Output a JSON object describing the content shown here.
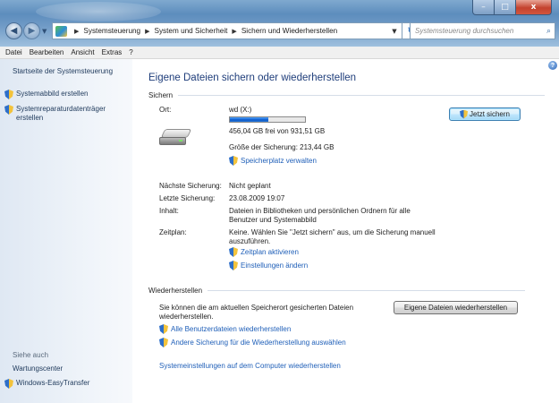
{
  "window": {
    "controls": {
      "minimize": "–",
      "maximize": "□",
      "close": "x"
    }
  },
  "address_bar": {
    "breadcrumbs": [
      "Systemsteuerung",
      "System und Sicherheit",
      "Sichern und Wiederherstellen"
    ],
    "search_placeholder": "Systemsteuerung durchsuchen"
  },
  "menubar": {
    "items": [
      "Datei",
      "Bearbeiten",
      "Ansicht",
      "Extras",
      "?"
    ]
  },
  "sidebar": {
    "home_link": "Startseite der Systemsteuerung",
    "links": [
      "Systemabbild erstellen",
      "Systemreparaturdatenträger",
      "erstellen"
    ],
    "see_also_heading": "Siehe auch",
    "see_also": [
      "Wartungscenter",
      "Windows-EasyTransfer"
    ]
  },
  "main": {
    "title": "Eigene Dateien sichern oder wiederherstellen",
    "backup": {
      "heading": "Sichern",
      "location_label": "Ort:",
      "drive_name": "wd (X:)",
      "drive_free": "456,04 GB frei von 931,51 GB",
      "drive_usage_fraction": 0.51,
      "backup_size": "Größe der Sicherung: 213,44 GB",
      "manage_space_link": "Speicherplatz verwalten",
      "backup_now_button": "Jetzt sichern",
      "next_backup_label": "Nächste Sicherung:",
      "next_backup_value": "Nicht geplant",
      "last_backup_label": "Letzte Sicherung:",
      "last_backup_value": "23.08.2009 19:07",
      "contents_label": "Inhalt:",
      "contents_value": [
        "Dateien in Bibliotheken und persönlichen Ordnern für alle",
        "Benutzer und Systemabbild"
      ],
      "schedule_label": "Zeitplan:",
      "schedule_value": [
        "Keine. Wählen Sie \"Jetzt sichern\" aus, um die Sicherung manuell",
        "auszuführen."
      ],
      "enable_schedule_link": "Zeitplan aktivieren",
      "change_settings_link": "Einstellungen ändern"
    },
    "restore": {
      "heading": "Wiederherstellen",
      "description": [
        "Sie können die am aktuellen Speicherort gesicherten Dateien",
        "wiederherstellen."
      ],
      "restore_files_button": "Eigene Dateien wiederherstellen",
      "restore_all_users_link": "Alle Benutzerdateien wiederherstellen",
      "select_other_backup_link": "Andere Sicherung für die Wiederherstellung auswählen",
      "recover_system_link": "Systemeinstellungen auf dem Computer wiederherstellen"
    }
  }
}
